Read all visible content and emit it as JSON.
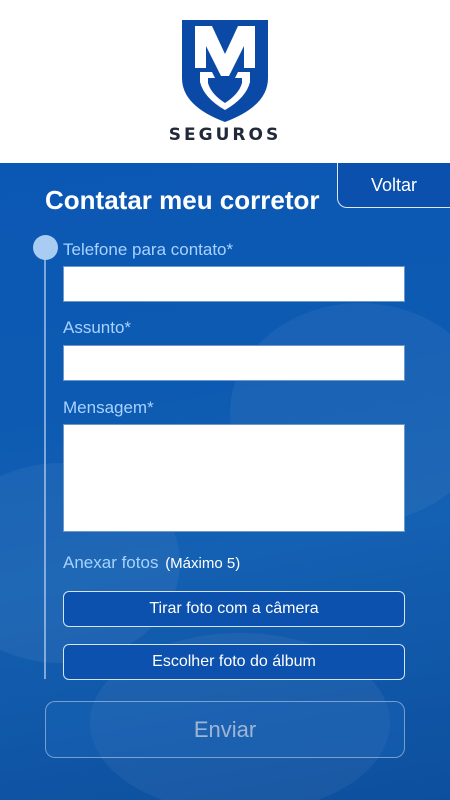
{
  "header": {
    "brand_name": "SEGUROS",
    "logo_icon": "mm-shield-logo",
    "brand_color": "#0a4aa6"
  },
  "form": {
    "title": "Contatar meu corretor",
    "back_label": "Voltar",
    "phone_label": "Telefone para contato*",
    "phone_value": "",
    "subject_label": "Assunto*",
    "subject_value": "",
    "message_label": "Mensagem*",
    "message_value": "",
    "attach_label": "Anexar fotos",
    "attach_limit": "(Máximo 5)",
    "camera_button": "Tirar foto com a câmera",
    "album_button": "Escolher foto do álbum",
    "send_button": "Enviar"
  },
  "colors": {
    "background": "#0b58b4",
    "label": "#a8d2ff",
    "timeline_dot": "#a9cdf2"
  }
}
